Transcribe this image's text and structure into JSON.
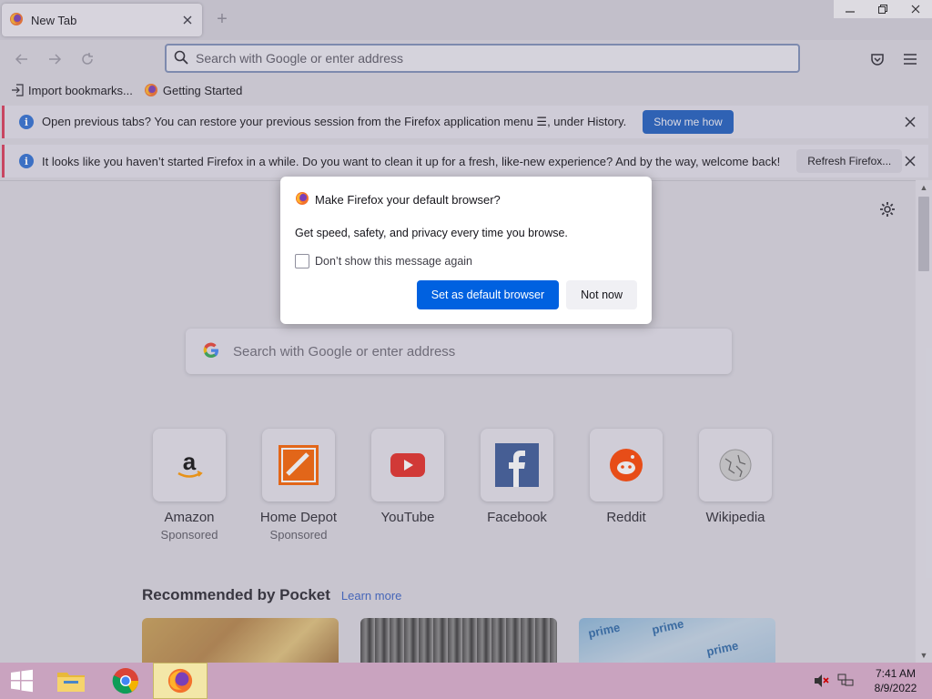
{
  "browser": {
    "tab_title": "New Tab",
    "url_placeholder": "Search with Google or enter address"
  },
  "bookmarks": [
    {
      "label": "Import bookmarks...",
      "icon": "import-icon"
    },
    {
      "label": "Getting Started",
      "icon": "firefox-icon"
    }
  ],
  "notifications": [
    {
      "message": "Open previous tabs? You can restore your previous session from the Firefox application menu ☰, under History.",
      "button": "Show me how"
    },
    {
      "message": "It looks like you haven’t started Firefox in a while. Do you want to clean it up for a fresh, like-new experience? And by the way, welcome back!",
      "button": "Refresh Firefox..."
    }
  ],
  "modal": {
    "title": "Make Firefox your default browser?",
    "body": "Get speed, safety, and privacy every time you browse.",
    "checkbox_label": "Don’t show this message again",
    "primary_button": "Set as default browser",
    "secondary_button": "Not now"
  },
  "newtab": {
    "search_placeholder": "Search with Google or enter address",
    "shortcuts": [
      {
        "label": "Amazon",
        "sub": "Sponsored",
        "icon": "amazon-icon"
      },
      {
        "label": "Home Depot",
        "sub": "Sponsored",
        "icon": "home-depot-icon"
      },
      {
        "label": "YouTube",
        "sub": "",
        "icon": "youtube-icon"
      },
      {
        "label": "Facebook",
        "sub": "",
        "icon": "facebook-icon"
      },
      {
        "label": "Reddit",
        "sub": "",
        "icon": "reddit-icon"
      },
      {
        "label": "Wikipedia",
        "sub": "",
        "icon": "wikipedia-icon"
      }
    ],
    "pocket_title": "Recommended by Pocket",
    "pocket_link": "Learn more",
    "card3_text": "prime"
  },
  "taskbar": {
    "time": "7:41 AM",
    "date": "8/9/2022"
  },
  "colors": {
    "accent": "#0061e0",
    "notif_button": "#1f5fbf",
    "notif_border": "#d93c5a",
    "taskbar": "#c9a3bf"
  }
}
